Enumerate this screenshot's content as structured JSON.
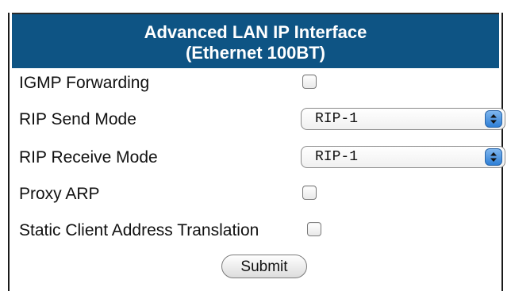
{
  "header": {
    "title_line1": "Advanced LAN IP Interface",
    "title_line2": "(Ethernet 100BT)"
  },
  "form": {
    "igmp_forwarding": {
      "label": "IGMP Forwarding",
      "checked": false
    },
    "rip_send_mode": {
      "label": "RIP Send Mode",
      "value": "RIP-1"
    },
    "rip_receive_mode": {
      "label": "RIP Receive Mode",
      "value": "RIP-1"
    },
    "proxy_arp": {
      "label": "Proxy ARP",
      "checked": false
    },
    "static_client_address_translation": {
      "label": "Static Client Address Translation",
      "checked": false
    },
    "submit_label": "Submit"
  },
  "colors": {
    "header_background": "#0e5484",
    "select_arrow_accent": "#2f7fd6"
  },
  "icons": {
    "select_arrows": "up-down-arrows-icon"
  }
}
